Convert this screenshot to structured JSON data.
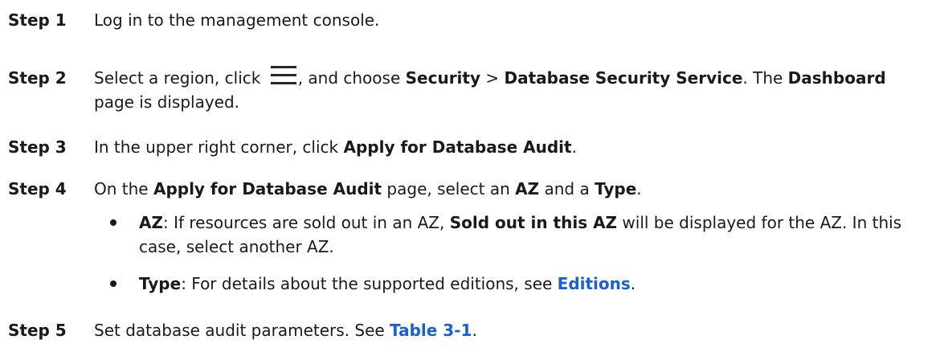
{
  "steps": [
    {
      "label": "Step 1",
      "parts": [
        {
          "t": "Log in to the management console."
        }
      ]
    },
    {
      "label": "Step 2",
      "parts": [
        {
          "t": "Select a region, click "
        },
        {
          "icon": "menu-icon"
        },
        {
          "t": ", and choose "
        },
        {
          "t": "Security",
          "b": true
        },
        {
          "t": " > "
        },
        {
          "t": "Database Security Service",
          "b": true
        },
        {
          "t": ". The "
        },
        {
          "t": "Dashboard",
          "b": true
        },
        {
          "t": " page is displayed."
        }
      ]
    },
    {
      "label": "Step 3",
      "parts": [
        {
          "t": "In the upper right corner, click "
        },
        {
          "t": "Apply for Database Audit",
          "b": true
        },
        {
          "t": "."
        }
      ]
    },
    {
      "label": "Step 4",
      "parts": [
        {
          "t": "On the "
        },
        {
          "t": "Apply for Database Audit",
          "b": true
        },
        {
          "t": " page, select an "
        },
        {
          "t": "AZ",
          "b": true
        },
        {
          "t": " and a "
        },
        {
          "t": "Type",
          "b": true
        },
        {
          "t": "."
        }
      ]
    },
    {
      "label": "Step 5",
      "parts": [
        {
          "t": "Set database audit parameters. See "
        },
        {
          "t": "Table 3-1",
          "link": true
        },
        {
          "t": "."
        }
      ]
    }
  ],
  "bullets": [
    {
      "parts": [
        {
          "t": "AZ",
          "b": true
        },
        {
          "t": ": If resources are sold out in an AZ, "
        },
        {
          "t": "Sold out in this AZ",
          "b": true
        },
        {
          "t": " will be displayed for the AZ. In this case, select another AZ."
        }
      ]
    },
    {
      "parts": [
        {
          "t": "Type",
          "b": true
        },
        {
          "t": ": For details about the supported editions, see "
        },
        {
          "t": "Editions",
          "link": true
        },
        {
          "t": "."
        }
      ]
    }
  ],
  "colors": {
    "text": "#1a1a1a",
    "link": "#1a5fd6"
  }
}
